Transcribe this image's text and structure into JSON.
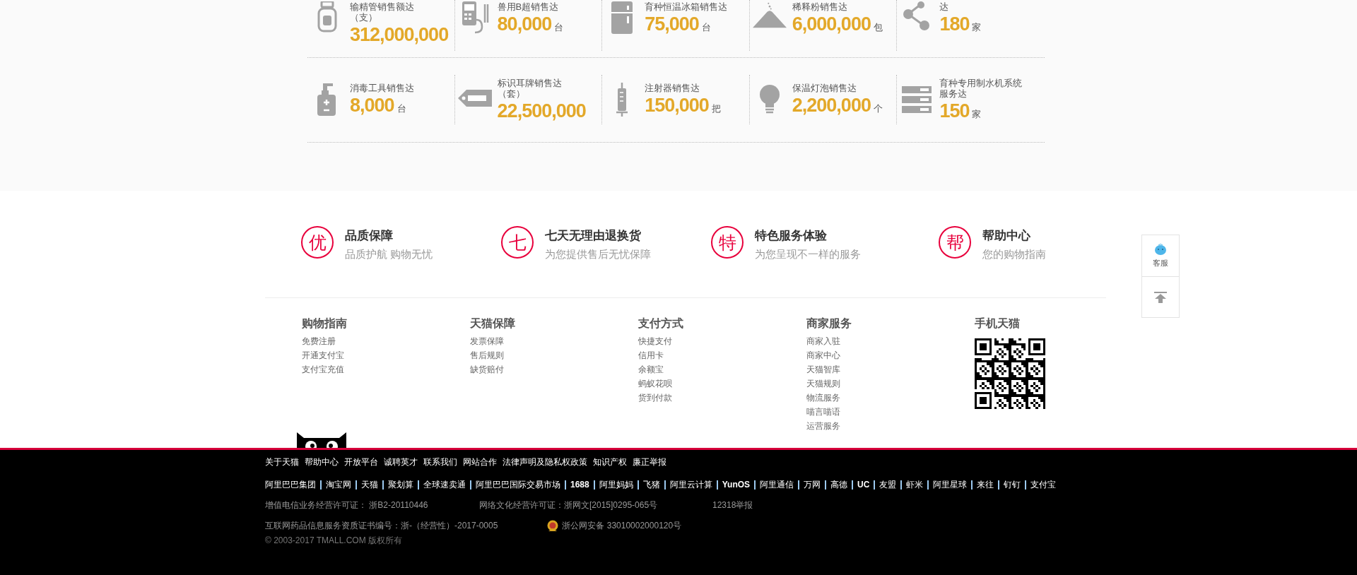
{
  "stats": [
    [
      {
        "kind": "jar",
        "label": "输精管销售额达（支）",
        "value": "312,000,000"
      },
      {
        "kind": "ultrasound",
        "label": "兽用B超销售达",
        "value": "80,000",
        "unit": "台"
      },
      {
        "kind": "fridge",
        "label": "育种恒温冰箱销售达",
        "value": "75,000",
        "unit": "台"
      },
      {
        "kind": "powder",
        "label": "稀释粉销售达",
        "value": "6,000,000",
        "unit": "包"
      },
      {
        "kind": "share",
        "label": "达",
        "value": "180",
        "unit": "家"
      }
    ],
    [
      {
        "kind": "sprayer",
        "label": "消毒工具销售达",
        "value": "8,000",
        "unit": "台"
      },
      {
        "kind": "tag",
        "label": "标识耳牌销售达（套）",
        "value": "22,500,000"
      },
      {
        "kind": "syringe",
        "label": "注射器销售达",
        "value": "150,000",
        "unit": "把"
      },
      {
        "kind": "bulb",
        "label": "保温灯泡销售达",
        "value": "2,200,000",
        "unit": "个"
      },
      {
        "kind": "server",
        "label": "育种专用制水机系统服务达",
        "value": "150",
        "unit": "家"
      }
    ]
  ],
  "services": [
    {
      "mark": "优",
      "title": "品质保障",
      "subtitle": "品质护航 购物无忧"
    },
    {
      "mark": "七",
      "title": "七天无理由退换货",
      "subtitle": "为您提供售后无忧保障"
    },
    {
      "mark": "特",
      "title": "特色服务体验",
      "subtitle": "为您呈现不一样的服务"
    },
    {
      "mark": "帮",
      "title": "帮助中心",
      "subtitle": "您的购物指南"
    }
  ],
  "footer_columns": [
    {
      "kind": "links",
      "title": "购物指南",
      "links": [
        "免费注册",
        "开通支付宝",
        "支付宝充值"
      ]
    },
    {
      "kind": "links",
      "title": "天猫保障",
      "links": [
        "发票保障",
        "售后规则",
        "缺货赔付"
      ]
    },
    {
      "kind": "links",
      "title": "支付方式",
      "links": [
        "快捷支付",
        "信用卡",
        "余额宝",
        "蚂蚁花呗",
        "货到付款"
      ]
    },
    {
      "kind": "links",
      "title": "商家服务",
      "links": [
        "商家入驻",
        "商家中心",
        "天猫智库",
        "天猫规则",
        "物流服务",
        "喵言喵语",
        "运营服务"
      ]
    },
    {
      "kind": "qr",
      "title": "手机天猫"
    }
  ],
  "side_tools": [
    {
      "kind": "service",
      "label": "客服"
    },
    {
      "kind": "top"
    }
  ],
  "footer": {
    "links": [
      "关于天猫",
      "帮助中心",
      "开放平台",
      "诚聘英才",
      "联系我们",
      "网站合作",
      "法律声明及隐私权政策",
      "知识产权",
      "廉正举报"
    ],
    "partners": [
      {
        "text": "阿里巴巴集团",
        "bold": false
      },
      {
        "text": "淘宝网",
        "bold": false
      },
      {
        "text": "天猫",
        "bold": false
      },
      {
        "text": "聚划算",
        "bold": false
      },
      {
        "text": "全球速卖通",
        "bold": false
      },
      {
        "text": "阿里巴巴国际交易市场",
        "bold": false
      },
      {
        "text": "1688",
        "bold": true
      },
      {
        "text": "阿里妈妈",
        "bold": false
      },
      {
        "text": "飞猪",
        "bold": false
      },
      {
        "text": "阿里云计算",
        "bold": false
      },
      {
        "text": "YunOS",
        "bold": true
      },
      {
        "text": "阿里通信",
        "bold": false
      },
      {
        "text": "万网",
        "bold": false
      },
      {
        "text": "高德",
        "bold": false
      },
      {
        "text": "UC",
        "bold": true
      },
      {
        "text": "友盟",
        "bold": false
      },
      {
        "text": "虾米",
        "bold": false
      },
      {
        "text": "阿里星球",
        "bold": false
      },
      {
        "text": "来往",
        "bold": false
      },
      {
        "text": "钉钉",
        "bold": false
      },
      {
        "text": "支付宝",
        "bold": false
      }
    ],
    "license_row_1": [
      "增值电信业务经营许可证： 浙B2-20110446",
      "网络文化经营许可证：浙网文[2015]0295-065号",
      "12318举报"
    ],
    "pharma_license": "互联网药品信息服务资质证书编号：浙-（经营性）-2017-0005",
    "police_record": "浙公网安备 33010002000120号",
    "copyright": "© 2003-2017 TMALL.COM 版权所有"
  }
}
